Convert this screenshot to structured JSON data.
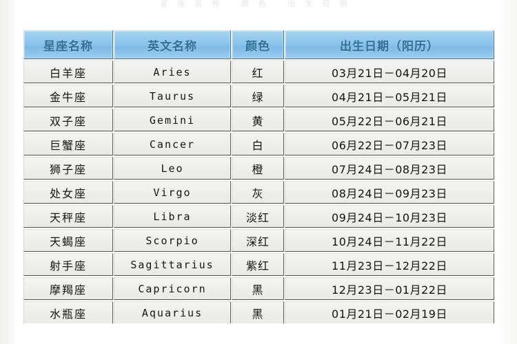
{
  "document": {
    "top_cut_text": "星座名称  颜色  出生日期"
  },
  "table": {
    "headers": [
      {
        "label": "星座名称",
        "key": "name"
      },
      {
        "label": "英文名称",
        "key": "english"
      },
      {
        "label": "颜色",
        "key": "color"
      },
      {
        "label": "出生日期（阳历）",
        "key": "date"
      }
    ],
    "header_bg": "#8cc4ec",
    "header_text_color": "#2f6f96",
    "cell_bg": "#eeefeb",
    "cell_text_color": "#141414",
    "rows": [
      {
        "name": "白羊座",
        "english": "Aries",
        "color": "红",
        "date": "03月21日－04月20日"
      },
      {
        "name": "金牛座",
        "english": "Taurus",
        "color": "绿",
        "date": "04月21日－05月21日"
      },
      {
        "name": "双子座",
        "english": "Gemini",
        "color": "黄",
        "date": "05月22日－06月21日"
      },
      {
        "name": "巨蟹座",
        "english": "Cancer",
        "color": "白",
        "date": "06月22日－07月23日"
      },
      {
        "name": "狮子座",
        "english": "Leo",
        "color": "橙",
        "date": "07月24日－08月23日"
      },
      {
        "name": "处女座",
        "english": "Virgo",
        "color": "灰",
        "date": "08月24日－09月23日"
      },
      {
        "name": "天秤座",
        "english": "Libra",
        "color": "淡红",
        "date": "09月24日－10月23日"
      },
      {
        "name": "天蝎座",
        "english": "Scorpio",
        "color": "深红",
        "date": "10月24日－11月22日"
      },
      {
        "name": "射手座",
        "english": "Sagittarius",
        "color": "紫红",
        "date": "11月23日－12月22日"
      },
      {
        "name": "摩羯座",
        "english": "Capricorn",
        "color": "黑",
        "date": "12月23日－01月22日"
      },
      {
        "name": "水瓶座",
        "english": "Aquarius",
        "color": "黑",
        "date": "01月21日－02月19日"
      }
    ]
  }
}
